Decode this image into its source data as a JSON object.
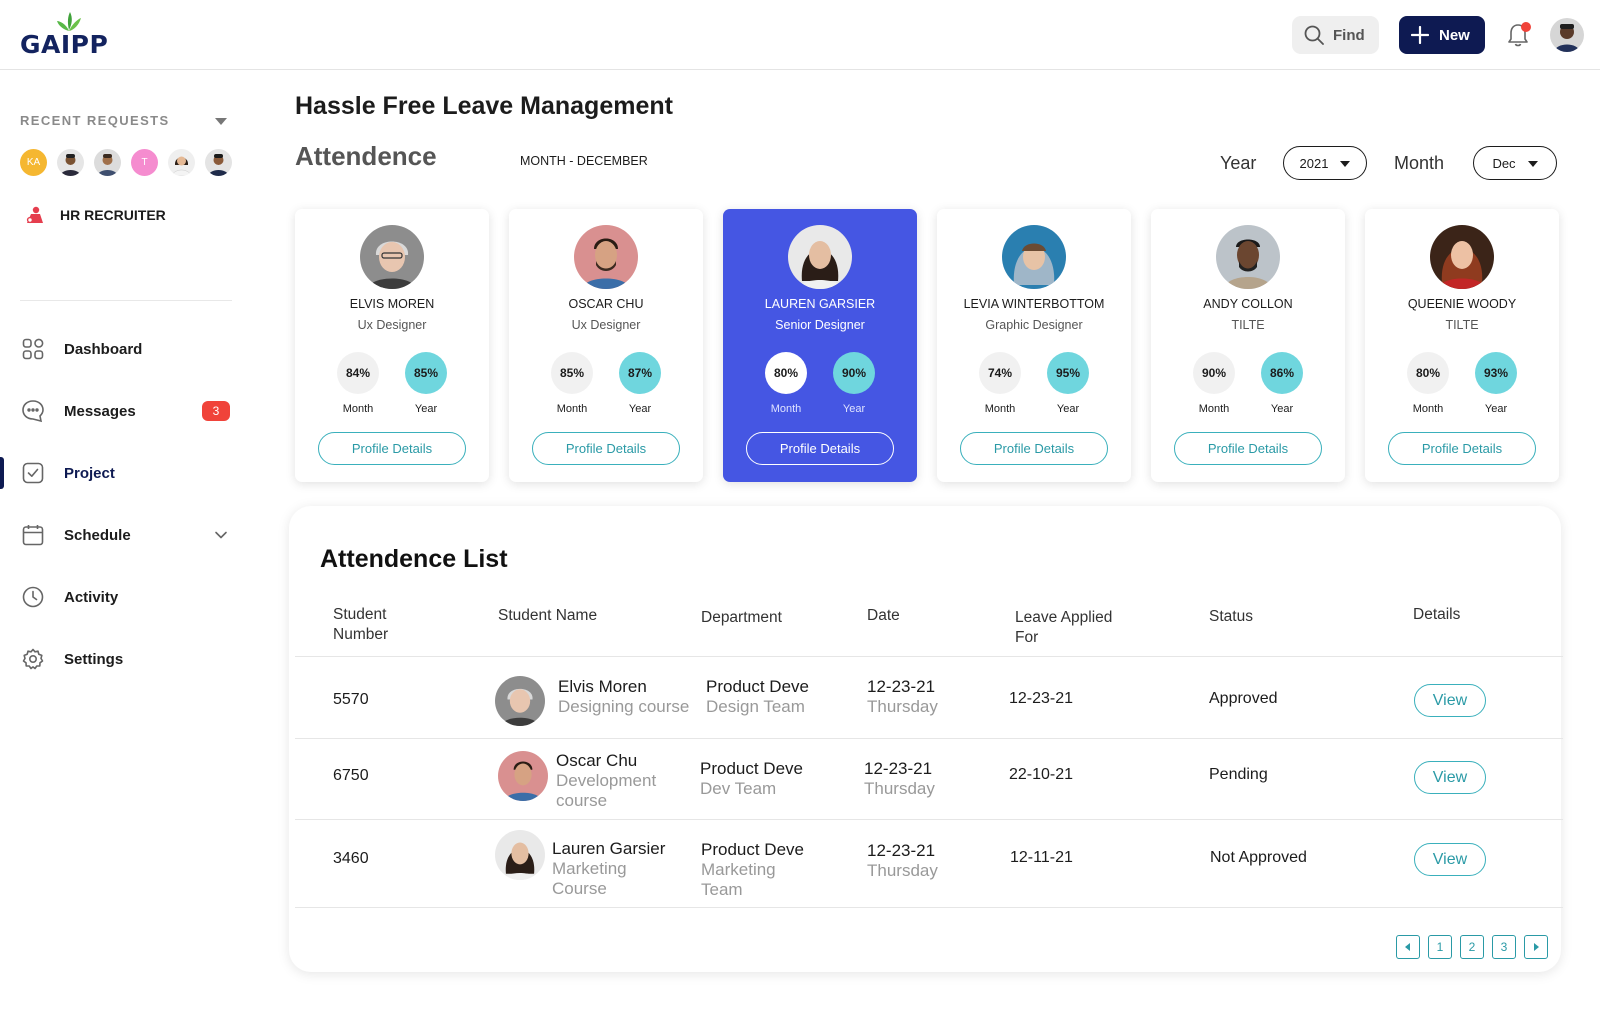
{
  "brand": {
    "name": "GAIPP"
  },
  "topbar": {
    "find_label": "Find",
    "new_label": "New"
  },
  "sidebar": {
    "recent_requests_title": "RECENT REQUESTS",
    "recent_avatars": [
      {
        "initials": "KA",
        "color": "#f5b731"
      },
      {
        "initials": "T",
        "color": "#f58ccf"
      }
    ],
    "hr_label": "HR RECRUITER",
    "nav": [
      {
        "label": "Dashboard",
        "icon": "grid-icon"
      },
      {
        "label": "Messages",
        "icon": "chat-icon",
        "badge": "3"
      },
      {
        "label": "Project",
        "icon": "check-square-icon",
        "active": true
      },
      {
        "label": "Schedule",
        "icon": "calendar-icon"
      },
      {
        "label": "Activity",
        "icon": "clock-icon"
      },
      {
        "label": "Settings",
        "icon": "gear-icon"
      }
    ]
  },
  "main": {
    "page_title": "Hassle Free Leave Management",
    "section_title": "Attendence",
    "month_label": "MONTH - DECEMBER",
    "year_label": "Year",
    "year_value": "2021",
    "month_title": "Month",
    "month_value": "Dec"
  },
  "employees": [
    {
      "name": "ELVIS MOREN",
      "role": "Ux Designer",
      "month": "84%",
      "year": "85%",
      "month_label": "Month",
      "year_label": "Year",
      "button": "Profile Details"
    },
    {
      "name": "OSCAR CHU",
      "role": "Ux Designer",
      "month": "85%",
      "year": "87%",
      "month_label": "Month",
      "year_label": "Year",
      "button": "Profile Details"
    },
    {
      "name": "LAUREN GARSIER",
      "role": "Senior Designer",
      "month": "80%",
      "year": "90%",
      "month_label": "Month",
      "year_label": "Year",
      "button": "Profile Details",
      "selected": true
    },
    {
      "name": "LEVIA WINTERBOTTOM",
      "role": "Graphic Designer",
      "month": "74%",
      "year": "95%",
      "month_label": "Month",
      "year_label": "Year",
      "button": "Profile Details"
    },
    {
      "name": "ANDY  COLLON",
      "role": "TILTE",
      "month": "90%",
      "year": "86%",
      "month_label": "Month",
      "year_label": "Year",
      "button": "Profile Details"
    },
    {
      "name": "QUEENIE WOODY",
      "role": "TILTE",
      "month": "80%",
      "year": "93%",
      "month_label": "Month",
      "year_label": "Year",
      "button": "Profile Details"
    }
  ],
  "attendance_list": {
    "title": "Attendence List",
    "headers": {
      "student_number_1": "Student",
      "student_number_2": "Number",
      "student_name": "Student Name",
      "department": "Department",
      "date": "Date",
      "leave_1": "Leave Applied",
      "leave_2": "For",
      "status": "Status",
      "details": "Details"
    },
    "rows": [
      {
        "number": "5570",
        "name": "Elvis Moren",
        "course": [
          "Designing course"
        ],
        "dept": "Product Deve",
        "team": [
          "Design Team"
        ],
        "date": "12-23-21",
        "day": "Thursday",
        "leave": "12-23-21",
        "status": "Approved",
        "action": "View"
      },
      {
        "number": "6750",
        "name": "Oscar Chu",
        "course": [
          "Development",
          "course"
        ],
        "dept": "Product Deve",
        "team": [
          "Dev Team"
        ],
        "date": "12-23-21",
        "day": "Thursday",
        "leave": "22-10-21",
        "status": "Pending",
        "action": "View"
      },
      {
        "number": "3460",
        "name": "Lauren Garsier",
        "course": [
          "Marketing",
          "Course"
        ],
        "dept": "Product Deve",
        "team": [
          "Marketing",
          "Team"
        ],
        "date": "12-23-21",
        "day": "Thursday",
        "leave": "12-11-21",
        "status": "Not Approved",
        "action": "View"
      }
    ],
    "pagination": {
      "pages": [
        "1",
        "2",
        "3"
      ]
    }
  },
  "colors": {
    "brand_navy": "#0e1a52",
    "accent_teal": "#3ab0bc",
    "selected_card": "#4556e3",
    "badge_red": "#f0433a"
  }
}
